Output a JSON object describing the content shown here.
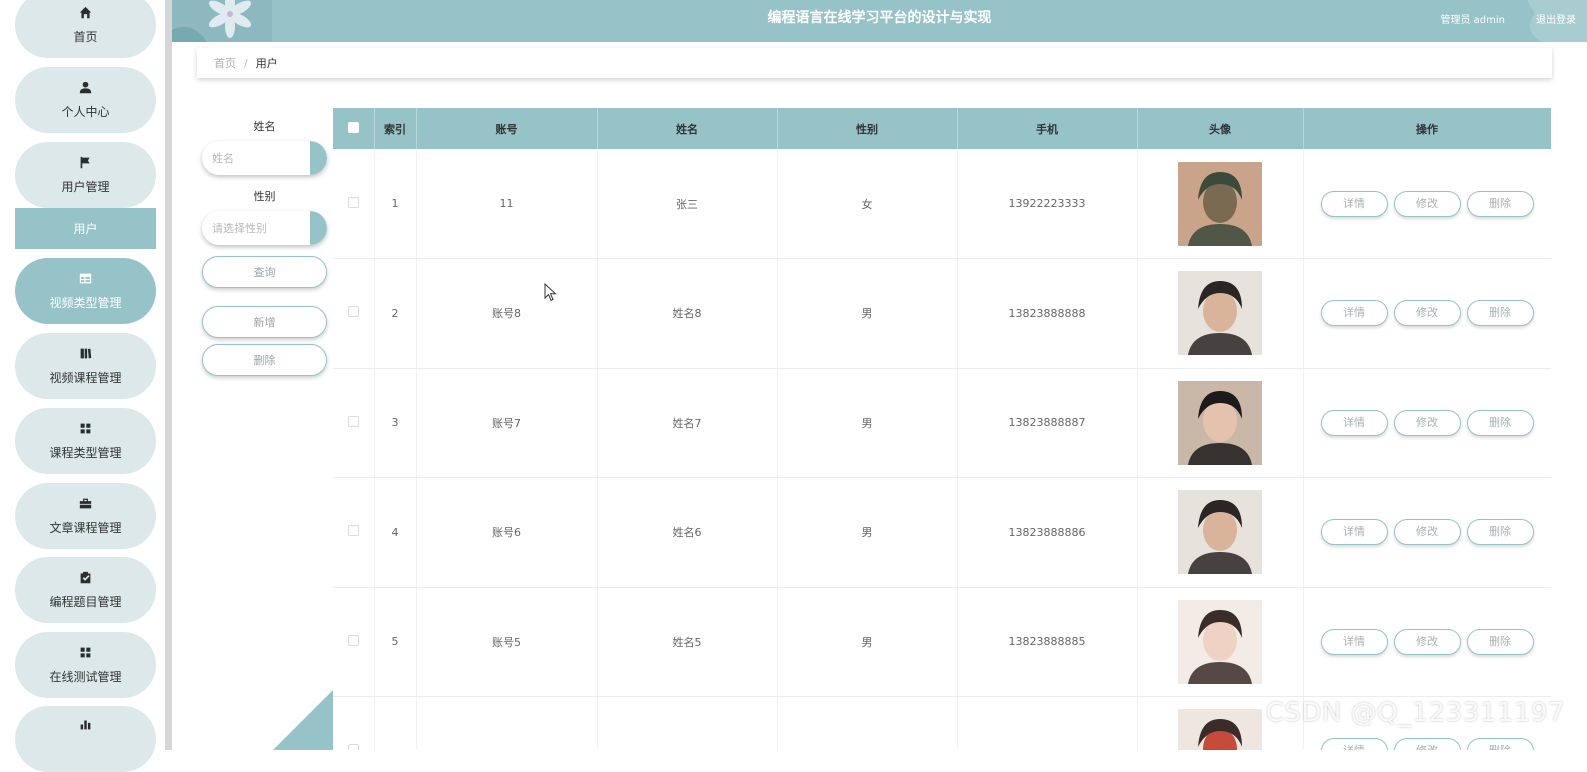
{
  "sidebar": {
    "items": [
      {
        "label": "首页",
        "icon": "home-icon"
      },
      {
        "label": "个人中心",
        "icon": "user-icon"
      },
      {
        "label": "用户管理",
        "icon": "flag-icon"
      },
      {
        "label": "视频类型管理",
        "icon": "table-icon"
      },
      {
        "label": "视频课程管理",
        "icon": "book-icon"
      },
      {
        "label": "课程类型管理",
        "icon": "grid-icon"
      },
      {
        "label": "文章课程管理",
        "icon": "briefcase-icon"
      },
      {
        "label": "编程题目管理",
        "icon": "clipboard-icon"
      },
      {
        "label": "在线测试管理",
        "icon": "grid-icon"
      },
      {
        "label": "",
        "icon": "bar-chart-icon"
      }
    ],
    "active_sub": "用户"
  },
  "header": {
    "title": "编程语言在线学习平台的设计与实现",
    "user": "管理员 admin",
    "logout": "退出登录"
  },
  "breadcrumb": {
    "home": "首页",
    "sep": "/",
    "current": "用户"
  },
  "filters": {
    "name_label": "姓名",
    "name_placeholder": "姓名",
    "gender_label": "性别",
    "gender_placeholder": "请选择性别",
    "query_button": "查询",
    "add_button": "新增",
    "delete_button": "删除"
  },
  "table": {
    "headers": [
      "索引",
      "账号",
      "姓名",
      "性别",
      "手机",
      "头像",
      "操作"
    ],
    "actions": [
      "详情",
      "修改",
      "删除"
    ],
    "rows": [
      {
        "index": "1",
        "account": "11",
        "name": "张三",
        "gender": "女",
        "phone": "13922223333",
        "avatar_colors": [
          "#3b4a3a",
          "#7a6a52",
          "#c9a48a"
        ]
      },
      {
        "index": "2",
        "account": "账号8",
        "name": "姓名8",
        "gender": "男",
        "phone": "13823888888",
        "avatar_colors": [
          "#2a2626",
          "#d9b49a",
          "#e8e2dc"
        ]
      },
      {
        "index": "3",
        "account": "账号7",
        "name": "姓名7",
        "gender": "男",
        "phone": "13823888887",
        "avatar_colors": [
          "#1c1a1a",
          "#e4c2ad",
          "#c9b8a8"
        ]
      },
      {
        "index": "4",
        "account": "账号6",
        "name": "姓名6",
        "gender": "男",
        "phone": "13823888886",
        "avatar_colors": [
          "#2a2626",
          "#d9b49a",
          "#e8e2dc"
        ]
      },
      {
        "index": "5",
        "account": "账号5",
        "name": "姓名5",
        "gender": "男",
        "phone": "13823888885",
        "avatar_colors": [
          "#3a2c28",
          "#efd2c4",
          "#f3ece6"
        ]
      },
      {
        "index": "",
        "account": "",
        "name": "",
        "gender": "",
        "phone": "",
        "avatar_colors": [
          "#3a2c28",
          "#c84a3a",
          "#f0e6e0"
        ]
      }
    ]
  },
  "watermark": "CSDN @Q_123311197",
  "colors": {
    "accent": "#95c3c8",
    "pill": "#dce8ea"
  }
}
